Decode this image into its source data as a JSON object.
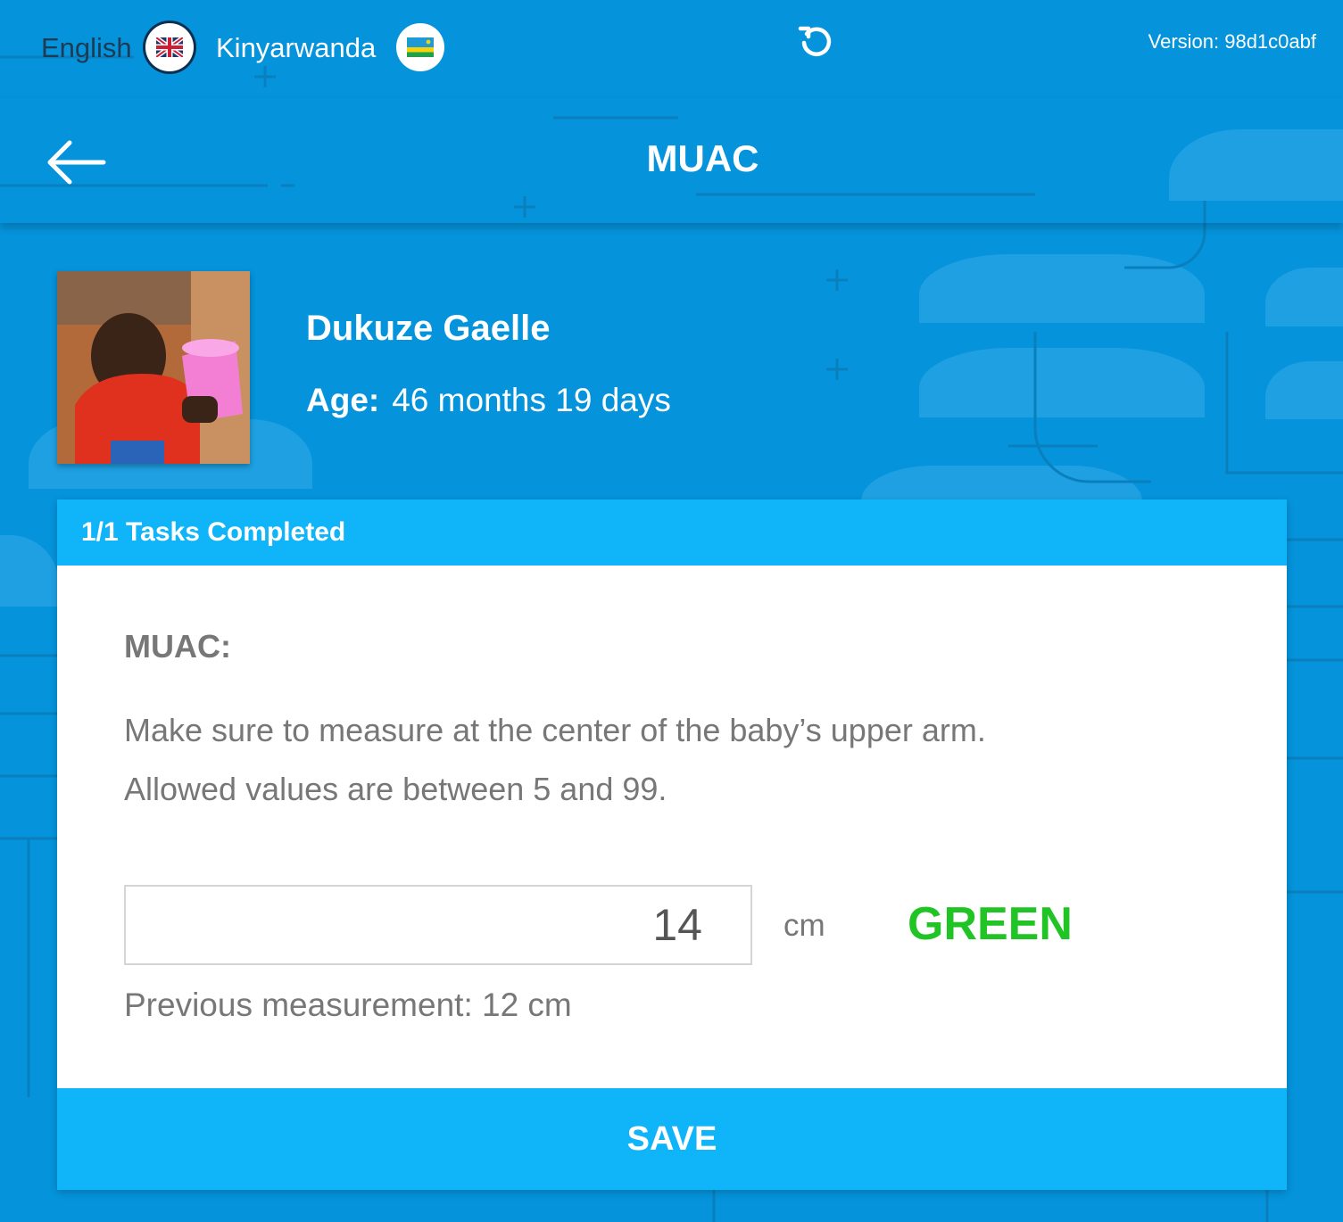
{
  "language_bar": {
    "english_label": "English",
    "kinyarwanda_label": "Kinyarwanda",
    "english_flag_icon": "uk-flag-icon",
    "kinyarwanda_flag_icon": "rwanda-flag-icon",
    "refresh_icon": "refresh-icon",
    "version": "Version: 98d1c0abf"
  },
  "header": {
    "back_icon": "arrow-left-icon",
    "title": "MUAC"
  },
  "participant": {
    "name": "Dukuze Gaelle",
    "age_label": "Age:",
    "age_value": "46 months 19 days"
  },
  "card": {
    "tasks_completed": "1/1 Tasks Completed",
    "form_title": "MUAC:",
    "help_line_1": "Make sure to measure at the center of the baby’s upper arm.",
    "help_line_2": "Allowed values are between 5 and 99.",
    "input_value": "14",
    "unit": "cm",
    "status": "GREEN",
    "previous_measurement": "Previous measurement: 12 cm",
    "save_label": "SAVE"
  },
  "colors": {
    "background": "#0593db",
    "accent": "#10b5f9",
    "status_green": "#21c425",
    "text_gray": "#777777"
  }
}
